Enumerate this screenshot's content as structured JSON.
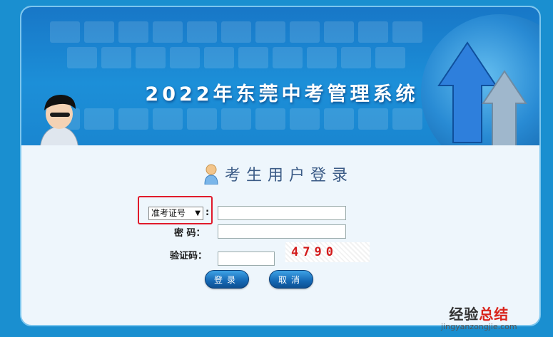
{
  "header": {
    "title": "2022年东莞中考管理系统"
  },
  "login": {
    "title": "考生用户登录",
    "id_type_selected": "准考证号",
    "id_type_colon": ":",
    "id_value": "",
    "password_label": "密 码：",
    "password_value": "",
    "captcha_label": "验证码：",
    "captcha_value": "",
    "captcha_image_text": "4790",
    "submit_label": "登录",
    "cancel_label": "取消"
  },
  "watermark": {
    "cn_part1": "经验",
    "cn_part2": "总结",
    "url": "jingyanzongjie.com"
  },
  "colors": {
    "banner": "#1a86d0",
    "highlight": "#e0192b",
    "captcha_text": "#d31b1b"
  },
  "icons": {
    "avatar": "user-avatar-icon",
    "login_user": "user-icon",
    "dropdown": "caret-down-icon"
  }
}
